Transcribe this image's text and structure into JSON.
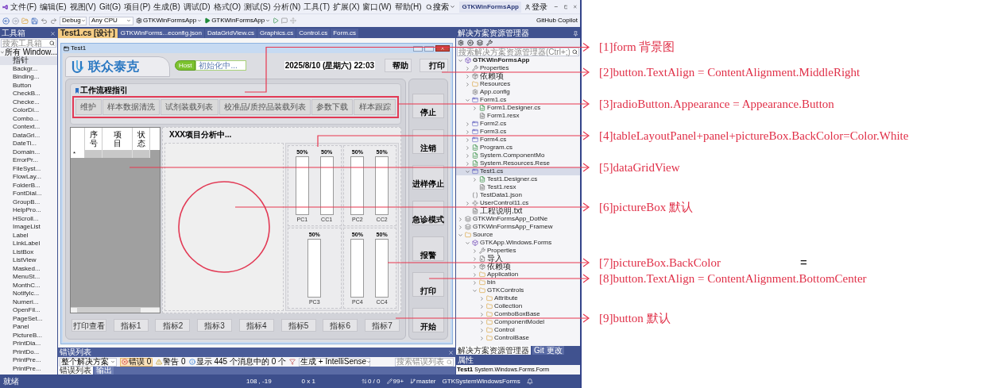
{
  "menu_bar": {
    "items": [
      "文件(F)",
      "编辑(E)",
      "视图(V)",
      "Git(G)",
      "项目(P)",
      "生成(B)",
      "调试(D)",
      "格式(O)",
      "测试(S)",
      "分析(N)",
      "工具(T)",
      "扩展(X)",
      "窗口(W)",
      "帮助(H)"
    ],
    "search": "搜索",
    "project_title": "GTKWinFormsApp",
    "sign_in": "登录"
  },
  "toolbar": {
    "configuration": "Debug",
    "platform": "Any CPU",
    "startup_project": "GTKWinFormsApp",
    "run_target": "GTKWinFormsApp",
    "copilot": "GitHub Copilot"
  },
  "toolbox": {
    "title": "工具箱",
    "search": {
      "placeholder": "搜索工具箱"
    },
    "group": {
      "label": "所有 Window...",
      "expanded": true
    },
    "items": [
      {
        "label": "指针",
        "selected": true
      },
      {
        "label": "Backgr...",
        "selected": false
      },
      {
        "label": "Binding...",
        "selected": false
      },
      {
        "label": "Button",
        "selected": false
      },
      {
        "label": "CheckB...",
        "selected": false
      },
      {
        "label": "Checke...",
        "selected": false
      },
      {
        "label": "ColorDi...",
        "selected": false
      },
      {
        "label": "Combo...",
        "selected": false
      },
      {
        "label": "Context...",
        "selected": false
      },
      {
        "label": "DataGri...",
        "selected": false
      },
      {
        "label": "DateTi...",
        "selected": false
      },
      {
        "label": "Domain...",
        "selected": false
      },
      {
        "label": "ErrorPr...",
        "selected": false
      },
      {
        "label": "FileSyst...",
        "selected": false
      },
      {
        "label": "FlowLay...",
        "selected": false
      },
      {
        "label": "FolderB...",
        "selected": false
      },
      {
        "label": "FontDial...",
        "selected": false
      },
      {
        "label": "GroupB...",
        "selected": false
      },
      {
        "label": "HelpPro...",
        "selected": false
      },
      {
        "label": "HScroll...",
        "selected": false
      },
      {
        "label": "ImageList",
        "selected": false
      },
      {
        "label": "Label",
        "selected": false
      },
      {
        "label": "LinkLabel",
        "selected": false
      },
      {
        "label": "ListBox",
        "selected": false
      },
      {
        "label": "ListView",
        "selected": false
      },
      {
        "label": "Masked...",
        "selected": false
      },
      {
        "label": "MenuSt...",
        "selected": false
      },
      {
        "label": "MonthC...",
        "selected": false
      },
      {
        "label": "NotifyIc...",
        "selected": false
      },
      {
        "label": "Numeri...",
        "selected": false
      },
      {
        "label": "OpenFil...",
        "selected": false
      },
      {
        "label": "PageSet...",
        "selected": false
      },
      {
        "label": "Panel",
        "selected": false
      },
      {
        "label": "PictureB...",
        "selected": false
      },
      {
        "label": "PrintDia...",
        "selected": false
      },
      {
        "label": "PrintDo...",
        "selected": false
      },
      {
        "label": "PrintPre...",
        "selected": false
      },
      {
        "label": "PrintPre...",
        "selected": false
      }
    ]
  },
  "document_tabs": [
    {
      "label": "Test1.cs [设计]",
      "selected": true
    },
    {
      "label": "GTKWinForms...econfig.json",
      "selected": false
    },
    {
      "label": "DataGridView.cs",
      "selected": false
    },
    {
      "label": "Graphics.cs",
      "selected": false
    },
    {
      "label": "Control.cs",
      "selected": false
    },
    {
      "label": "Form.cs",
      "selected": false
    }
  ],
  "form": {
    "title": "Test1",
    "brand": "联众泰克",
    "host_badge": "Host",
    "host_status": "初始化中...",
    "datetime": "2025/8/10 (星期六) 22:03",
    "header_buttons": [
      "帮助",
      "打印"
    ],
    "workflow": {
      "title": "工作流程指引",
      "options": [
        {
          "label": "维护",
          "selected": false
        },
        {
          "label": "样本数据清洗",
          "selected": false
        },
        {
          "label": "试剂装载列表",
          "selected": false
        },
        {
          "label": "校准品/质控品装载列表",
          "selected": false
        },
        {
          "label": "参数下载",
          "selected": false
        },
        {
          "label": "样本跟踪",
          "selected": false
        }
      ]
    },
    "grid": {
      "columns": [
        "序号",
        "项目",
        "状态"
      ],
      "new_row_marker": "*"
    },
    "analysis_title": "XXX项目分析中...",
    "gauges": [
      {
        "cells": [
          {
            "reading": "50%",
            "label": "PC1"
          },
          {
            "reading": "50%",
            "label": "CC1"
          }
        ]
      },
      {
        "cells": [
          {
            "reading": "50%",
            "label": "PC2"
          },
          {
            "reading": "50%",
            "label": "CC2"
          }
        ]
      },
      {
        "cells": [
          {
            "reading": "50%",
            "label": "PC3"
          }
        ]
      },
      {
        "cells": [
          {
            "reading": "50%",
            "label": "PC4"
          },
          {
            "reading": "50%",
            "label": "CC4"
          }
        ]
      }
    ],
    "side_buttons": [
      "停止",
      "注销",
      "进样停止",
      "急诊模式",
      "报警",
      "打印",
      "开始"
    ],
    "bottom_buttons": [
      "打印查看",
      "指标1",
      "指标2",
      "指标3",
      "指标4",
      "指标5",
      "指标6",
      "指标7"
    ]
  },
  "error_list": {
    "title": "错误列表",
    "scope": "整个解决方案",
    "errors": "错误 0",
    "warnings": "警告 0",
    "messages": "显示 445 个消息中的 0 个",
    "source": "生成 + IntelliSense",
    "search": {
      "placeholder": "搜索错误列表"
    },
    "tabs": [
      {
        "label": "错误列表",
        "selected": true
      },
      {
        "label": "输出",
        "selected": false
      }
    ]
  },
  "solution_explorer": {
    "title": "解决方案资源管理器",
    "search": {
      "placeholder": "搜索解决方案资源管理器(Ctrl+;)"
    },
    "tree": [
      {
        "label": "GTKWinFormsApp",
        "kind": "project",
        "expanded": true,
        "selected": false,
        "children": [
          {
            "label": "Properties",
            "kind": "properties",
            "expanded": false,
            "selected": false
          },
          {
            "label": "依赖项",
            "kind": "deps",
            "expanded": false,
            "selected": false
          },
          {
            "label": "Resources",
            "kind": "folder",
            "expanded": false,
            "selected": false
          },
          {
            "label": "App.config",
            "kind": "config",
            "selected": false
          },
          {
            "label": "Form1.cs",
            "kind": "form",
            "expanded": true,
            "selected": false,
            "children": [
              {
                "label": "Form1.Designer.cs",
                "kind": "cs",
                "expanded": false,
                "selected": false
              },
              {
                "label": "Form1.resx",
                "kind": "resx",
                "selected": false
              }
            ]
          },
          {
            "label": "Form2.cs",
            "kind": "form",
            "expanded": false,
            "selected": false
          },
          {
            "label": "Form3.cs",
            "kind": "form",
            "expanded": false,
            "selected": false
          },
          {
            "label": "Form4.cs",
            "kind": "form",
            "expanded": false,
            "selected": false
          },
          {
            "label": "Program.cs",
            "kind": "cs",
            "expanded": false,
            "selected": false
          },
          {
            "label": "System.ComponentMo",
            "kind": "cs",
            "expanded": false,
            "selected": false
          },
          {
            "label": "System.Resources.Rese",
            "kind": "cs",
            "expanded": false,
            "selected": false
          },
          {
            "label": "Test1.cs",
            "kind": "form",
            "expanded": true,
            "selected": true,
            "children": [
              {
                "label": "Test1.Designer.cs",
                "kind": "cs",
                "expanded": false,
                "selected": false
              },
              {
                "label": "Test1.resx",
                "kind": "resx",
                "selected": false
              }
            ]
          },
          {
            "label": "TestData1.json",
            "kind": "json",
            "selected": false
          },
          {
            "label": "UserControl11.cs",
            "kind": "control",
            "expanded": false,
            "selected": false
          },
          {
            "label": "工程说明.txt",
            "kind": "txt",
            "selected": false
          }
        ]
      },
      {
        "label": "GTKWinFormsApp_DotNe",
        "kind": "shared",
        "expanded": false,
        "selected": false
      },
      {
        "label": "GTKWinFormsApp_Framew",
        "kind": "shared",
        "expanded": false,
        "selected": false
      },
      {
        "label": "Source",
        "kind": "folder",
        "expanded": true,
        "selected": false,
        "children": [
          {
            "label": "GTKApp.Windows.Forms",
            "kind": "project",
            "expanded": true,
            "selected": false,
            "children": [
              {
                "label": "Properties",
                "kind": "properties",
                "expanded": false,
                "selected": false
              },
              {
                "label": "导入",
                "kind": "import",
                "expanded": false,
                "selected": false
              },
              {
                "label": "依赖项",
                "kind": "deps",
                "expanded": false,
                "selected": false
              },
              {
                "label": "Application",
                "kind": "folder",
                "expanded": false,
                "selected": false
              },
              {
                "label": "bin",
                "kind": "folder",
                "expanded": false,
                "selected": false
              },
              {
                "label": "GTKControls",
                "kind": "folder",
                "expanded": true,
                "selected": false,
                "children": [
                  {
                    "label": "Attribute",
                    "kind": "folder",
                    "expanded": false,
                    "selected": false
                  },
                  {
                    "label": "Collection",
                    "kind": "folder",
                    "expanded": false,
                    "selected": false
                  },
                  {
                    "label": "ComboBoxBase",
                    "kind": "folder",
                    "expanded": false,
                    "selected": false
                  },
                  {
                    "label": "ComponentModel",
                    "kind": "folder",
                    "expanded": false,
                    "selected": false
                  },
                  {
                    "label": "Control",
                    "kind": "folder",
                    "expanded": false,
                    "selected": false
                  },
                  {
                    "label": "ControlBase",
                    "kind": "folder",
                    "expanded": false,
                    "selected": false
                  }
                ]
              }
            ]
          }
        ]
      }
    ],
    "tabs": [
      {
        "label": "解决方案资源管理器",
        "selected": true
      },
      {
        "label": "Git 更改",
        "selected": false
      }
    ]
  },
  "properties": {
    "title": "属性",
    "object": "Test1",
    "type": "System.Windows.Forms.Form"
  },
  "status_bar": {
    "status": "就绪",
    "position": "108 , -19",
    "selection": "0 x 1",
    "changes": "0 / 0",
    "edits": "99+",
    "branch": "master",
    "repository": "GTKSystemWindowsForms"
  },
  "annotations": [
    {
      "label": "[1]form 背景图"
    },
    {
      "label": "[2]button.TextAlign = ContentAlignment.MiddleRight"
    },
    {
      "label": "[3]radioButton.Appearance = Appearance.Button"
    },
    {
      "label": "[4]tableLayoutPanel+panel+pictureBox.BackColor=Color.White"
    },
    {
      "label": "[5]dataGridView"
    },
    {
      "label": "[6]pictureBox 默认"
    },
    {
      "label": "[7]pictureBox.BackColor",
      "suffix": "="
    },
    {
      "label": "[8]button.TextAlign = ContentAlignment.BottomCenter"
    },
    {
      "label": "[9]button 默认"
    }
  ]
}
